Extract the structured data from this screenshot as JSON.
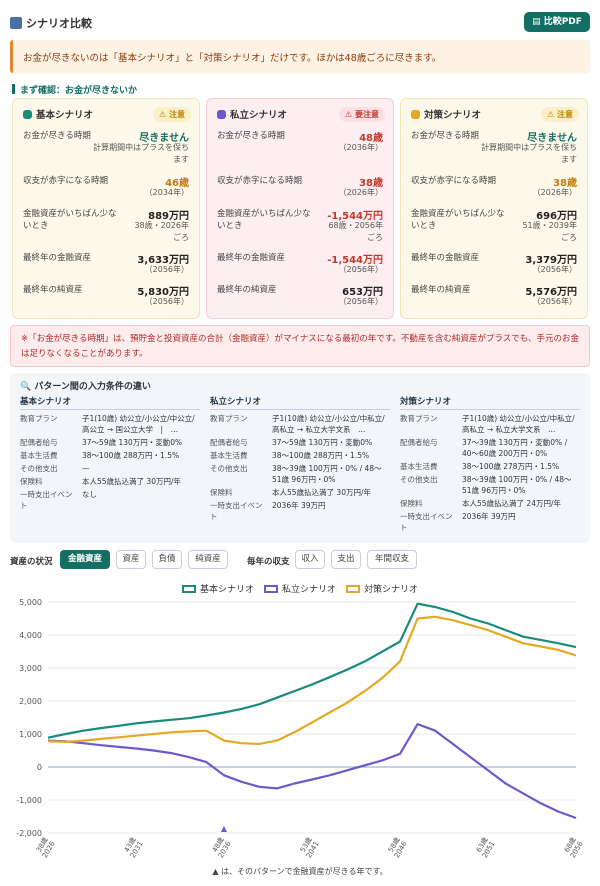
{
  "header": {
    "title": "シナリオ比較",
    "pdf_button": "比較PDF"
  },
  "alert": {
    "text": "お金が尽きないのは「基本シナリオ」と「対策シナリオ」だけです。ほかは48歳ごろに尽きます。"
  },
  "section": {
    "label": "まず確認：お金が尽きないか"
  },
  "cards": [
    {
      "name": "基本シナリオ",
      "badge": "注意",
      "color": "#1a8a7a",
      "badge_color": "#b8860b",
      "rows": [
        {
          "label": "お金が尽きる時期",
          "value": "尽きません",
          "sub": "計算期間中はプラスを保ちます"
        },
        {
          "label": "収支が赤字になる時期",
          "value": "46歳",
          "sub": "（2034年）"
        },
        {
          "label": "金融資産がいちばん少ないとき",
          "value": "889万円",
          "sub": "38歳・2026年ごろ"
        },
        {
          "label": "最終年の金融資産",
          "value": "3,633万円",
          "sub": "（2056年）"
        },
        {
          "label": "最終年の純資産",
          "value": "5,830万円",
          "sub": "（2056年）"
        }
      ]
    },
    {
      "name": "私立シナリオ",
      "badge": "要注意",
      "color": "#6a5acd",
      "badge_color": "#c0392b",
      "rows": [
        {
          "label": "お金が尽きる時期",
          "value": "48歳",
          "sub": "（2036年）"
        },
        {
          "label": "収支が赤字になる時期",
          "value": "38歳",
          "sub": "（2026年）"
        },
        {
          "label": "金融資産がいちばん少ないとき",
          "value": "-1,544万円",
          "sub": "68歳・2056年ごろ"
        },
        {
          "label": "最終年の金融資産",
          "value": "-1,544万円",
          "sub": "（2056年）"
        },
        {
          "label": "最終年の純資産",
          "value": "653万円",
          "sub": "（2056年）"
        }
      ]
    },
    {
      "name": "対策シナリオ",
      "badge": "注意",
      "color": "#e5a823",
      "badge_color": "#b8860b",
      "rows": [
        {
          "label": "お金が尽きる時期",
          "value": "尽きません",
          "sub": "計算期間中はプラスを保ちます"
        },
        {
          "label": "収支が赤字になる時期",
          "value": "38歳",
          "sub": "（2026年）"
        },
        {
          "label": "金融資産がいちばん少ないとき",
          "value": "696万円",
          "sub": "51歳・2039年ごろ"
        },
        {
          "label": "最終年の金融資産",
          "value": "3,379万円",
          "sub": "（2056年）"
        },
        {
          "label": "最終年の純資産",
          "value": "5,576万円",
          "sub": "（2056年）"
        }
      ]
    }
  ],
  "note": {
    "text": "※「お金が尽きる時期」は、預貯金と投資資産の合計（金融資産）がマイナスになる最初の年です。不動産を含む純資産がプラスでも、手元のお金は足りなくなることがあります。"
  },
  "conditions": {
    "title": "パターン間の入力条件の違い",
    "columns": [
      {
        "name": "基本シナリオ",
        "rows": [
          {
            "k": "教育プラン",
            "v": "子1(10歳) 幼公立/小公立/中公立/高公立 → 国公立大学　|　…"
          },
          {
            "k": "配偶者給与",
            "v": "37〜59歳 130万円・変動0%"
          },
          {
            "k": "基本生活費",
            "v": "38〜100歳 288万円・1.5%"
          },
          {
            "k": "その他支出",
            "v": "—"
          },
          {
            "k": "保険料",
            "v": "本人55歳払込満了 30万円/年"
          },
          {
            "k": "一時支出イベント",
            "v": "なし"
          }
        ]
      },
      {
        "name": "私立シナリオ",
        "rows": [
          {
            "k": "教育プラン",
            "v": "子1(10歳) 幼公立/小公立/中私立/高私立 → 私立大学文系　…"
          },
          {
            "k": "配偶者給与",
            "v": "37〜59歳 130万円・変動0%"
          },
          {
            "k": "基本生活費",
            "v": "38〜100歳 288万円・1.5%"
          },
          {
            "k": "その他支出",
            "v": "38〜39歳 100万円・0% / 48〜51歳 96万円・0%"
          },
          {
            "k": "保険料",
            "v": "本人55歳払込満了 30万円/年"
          },
          {
            "k": "一時支出イベント",
            "v": "2036年 39万円"
          }
        ]
      },
      {
        "name": "対策シナリオ",
        "rows": [
          {
            "k": "教育プラン",
            "v": "子1(10歳) 幼公立/小公立/中私立/高私立 → 私立大学文系　…"
          },
          {
            "k": "配偶者給与",
            "v": "37〜39歳 130万円・変動0% / 40〜60歳 200万円・0%"
          },
          {
            "k": "基本生活費",
            "v": "38〜100歳 278万円・1.5%"
          },
          {
            "k": "その他支出",
            "v": "38〜39歳 100万円・0% / 48〜51歳 96万円・0%"
          },
          {
            "k": "保険料",
            "v": "本人55歳払込満了 24万円/年"
          },
          {
            "k": "一時支出イベント",
            "v": "2036年 39万円"
          }
        ]
      }
    ]
  },
  "tabs": {
    "asset_label": "資産の状況",
    "asset_tabs": [
      "金融資産",
      "資産",
      "負債",
      "純資産"
    ],
    "flow_label": "毎年の収支",
    "flow_tabs": [
      "収入",
      "支出",
      "年間収支"
    ],
    "active": "金融資産"
  },
  "chart_data": {
    "type": "line",
    "ylim": [
      -2000,
      5000
    ],
    "yticks": [
      -2000,
      -1000,
      0,
      1000,
      2000,
      3000,
      4000,
      5000
    ],
    "x_years": [
      2026,
      2027,
      2028,
      2029,
      2030,
      2031,
      2032,
      2033,
      2034,
      2035,
      2036,
      2037,
      2038,
      2039,
      2040,
      2041,
      2042,
      2043,
      2044,
      2045,
      2046,
      2047,
      2048,
      2049,
      2050,
      2051,
      2052,
      2053,
      2054,
      2055,
      2056
    ],
    "x_tick_labels": [
      {
        "age": "38歳",
        "year": "2026",
        "x": 2026
      },
      {
        "age": "43歳",
        "year": "2031",
        "x": 2031
      },
      {
        "age": "48歳",
        "year": "2036",
        "x": 2036
      },
      {
        "age": "53歳",
        "year": "2041",
        "x": 2041
      },
      {
        "age": "58歳",
        "year": "2046",
        "x": 2046
      },
      {
        "age": "63歳",
        "year": "2051",
        "x": 2051
      },
      {
        "age": "68歳",
        "year": "2056",
        "x": 2056
      }
    ],
    "marker_year": 2036,
    "series": [
      {
        "name": "基本シナリオ",
        "color": "#1a8a7a",
        "values": [
          889,
          1000,
          1100,
          1180,
          1250,
          1320,
          1380,
          1430,
          1480,
          1560,
          1650,
          1760,
          1900,
          2100,
          2300,
          2500,
          2720,
          2950,
          3200,
          3500,
          3800,
          4950,
          4850,
          4700,
          4500,
          4350,
          4150,
          3950,
          3850,
          3750,
          3633
        ]
      },
      {
        "name": "私立シナリオ",
        "color": "#6a5acd",
        "values": [
          800,
          780,
          720,
          660,
          610,
          560,
          500,
          420,
          300,
          150,
          -250,
          -450,
          -600,
          -650,
          -500,
          -380,
          -250,
          -100,
          50,
          200,
          400,
          1300,
          1100,
          700,
          300,
          -100,
          -500,
          -800,
          -1100,
          -1350,
          -1544
        ]
      },
      {
        "name": "対策シナリオ",
        "color": "#e5a823",
        "values": [
          780,
          760,
          800,
          850,
          900,
          950,
          1000,
          1050,
          1080,
          1100,
          800,
          720,
          700,
          800,
          1050,
          1350,
          1650,
          1950,
          2300,
          2700,
          3200,
          4500,
          4550,
          4450,
          4300,
          4150,
          3950,
          3750,
          3650,
          3550,
          3379
        ]
      }
    ]
  },
  "footnote": {
    "text": "▲ は、そのパターンで金融資産が尽きる年です。"
  }
}
